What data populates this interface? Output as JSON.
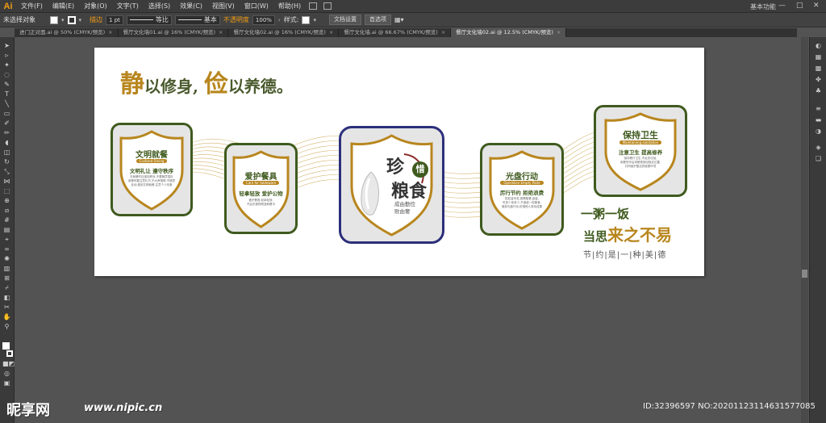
{
  "app": {
    "logo": "Ai",
    "menus": [
      "文件(F)",
      "编辑(E)",
      "对象(O)",
      "文字(T)",
      "选择(S)",
      "效果(C)",
      "视图(V)",
      "窗口(W)",
      "帮助(H)"
    ],
    "workspace": "基本功能",
    "window_controls": [
      "—",
      "□",
      "✕"
    ]
  },
  "control_bar": {
    "selection": "未选择对象",
    "stroke_label": "描边",
    "stroke_weight": "1 pt",
    "profile_label": "等比",
    "brush_label": "基本",
    "opacity_label": "不透明度",
    "opacity_value": "100%",
    "style_label": "样式:",
    "doc_setup": "文档设置",
    "preferences": "首选项"
  },
  "tabs": [
    {
      "label": "进门正对面.ai @ 50% (CMYK/预览)",
      "active": false
    },
    {
      "label": "餐厅文化墙01.ai @ 16% (CMYK/预览)",
      "active": false
    },
    {
      "label": "餐厅文化墙02.ai @ 16% (CMYK/预览)",
      "active": false
    },
    {
      "label": "餐厅文化墙.ai @ 66.67% (CMYK/预览)",
      "active": false
    },
    {
      "label": "餐厅文化墙02.ai @ 12.5% (CMYK/预览)",
      "active": true
    }
  ],
  "artwork": {
    "headline": {
      "c1": "静",
      "t1": "以修身,",
      "c2": "俭",
      "t2": "以养德。"
    },
    "cards": [
      {
        "title": "文明就餐",
        "pill": "Civilized Dining",
        "sub": "文明礼让 遵守秩序",
        "body": [
          "在就餐时应保持秩序,不要随意插队",
          "用餐时要注意礼节,不大声喧哗,不随意",
          "走动,做到文明就餐,注意个人形象"
        ]
      },
      {
        "title": "爱护餐具",
        "pill": "Care for tableware",
        "sub": "轻拿轻放 爱护公物",
        "body": [
          "爱护餐具,轻拿轻放,",
          "不乱扔食物残渣和餐巾"
        ]
      },
      {
        "char1": "珍",
        "char_circle": "惜",
        "char2": "粮食",
        "sub1": "成由勤俭",
        "sub2": "败由奢"
      },
      {
        "title": "光盘行动",
        "pill": "Operation Empty Plate",
        "sub": "厉行节约 拒绝浪费",
        "body": [
          "粒粒皆辛苦,按需取餐,适量,",
          "吃多少拿多少,不浪费一粒粮食,",
          "做到光盘行动,珍惜他人劳动成果"
        ]
      },
      {
        "title": "保持卫生",
        "pill": "Maintaining sanitation",
        "sub": "注意卫生 提高修养",
        "body": [
          "保持餐厅卫生,不乱扔垃圾,",
          "用餐完毕后将餐具放回指定位置,",
          "共同维护整洁的就餐环境"
        ]
      }
    ],
    "slogan": {
      "line1": "一粥一饭",
      "line2a": "当思",
      "line2b": "来之不易",
      "line3": "节|约|是|一|种|美|德"
    }
  },
  "watermark": {
    "logo": "昵享网",
    "url": "www.nipic.cn",
    "id": "ID:32396597 NO:20201123114631577085"
  }
}
